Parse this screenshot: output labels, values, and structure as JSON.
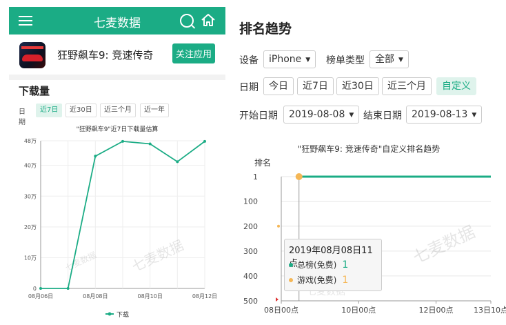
{
  "left": {
    "header": {
      "title": "七麦数据"
    },
    "app": {
      "name": "狂野飙车9: 竞速传奇",
      "follow_label": "关注应用"
    },
    "downloads": {
      "section_title": "下载量",
      "filter_label": "日期",
      "filters": [
        "近7日",
        "近30日",
        "近三个月",
        "近一年"
      ],
      "active_filter": "近7日"
    }
  },
  "right": {
    "title": "排名趋势",
    "device_label": "设备",
    "device_value": "iPhone",
    "chart_type_label": "榜单类型",
    "chart_type_value": "全部",
    "date_label": "日期",
    "date_chips": [
      "今日",
      "近7日",
      "近30日",
      "近三个月",
      "自定义"
    ],
    "active_date": "自定义",
    "start_label": "开始日期",
    "start_value": "2019-08-08",
    "end_label": "结束日期",
    "end_value": "2019-08-13",
    "tooltip": {
      "title": "2019年08月08日11点",
      "rows": [
        {
          "label": "总榜(免费)",
          "value": "1",
          "color": "#1bac85"
        },
        {
          "label": "游戏(免费)",
          "value": "1",
          "color": "#f5b756"
        }
      ]
    },
    "watermark": "七麦数据"
  },
  "colors": {
    "accent": "#1bac85",
    "orange": "#f5b756"
  },
  "chart_data": [
    {
      "type": "line",
      "title": "\"狂野飙车9\"近7日下载量估算",
      "x": [
        "08月06日",
        "08月07日",
        "08月08日",
        "08月09日",
        "08月10日",
        "08月11日",
        "08月12日"
      ],
      "x_tick_labels": [
        "08月06日",
        "08月08日",
        "08月10日",
        "08月12日"
      ],
      "y_tick_labels": [
        "0",
        "10万",
        "20万",
        "30万",
        "40万",
        "48万"
      ],
      "ylim": [
        0,
        480000
      ],
      "series": [
        {
          "name": "下载",
          "color": "#1bac85",
          "values": [
            0,
            0,
            430000,
            478000,
            470000,
            412000,
            478000
          ]
        }
      ],
      "legend": "bottom-center",
      "watermark": "七麦数据"
    },
    {
      "type": "line",
      "title": "\"狂野飙车9: 竞速传奇\"自定义排名趋势",
      "ylabel": "排名",
      "y_inverted": true,
      "ylim": [
        1,
        500
      ],
      "y_tick_labels": [
        "1",
        "100",
        "200",
        "300",
        "400",
        "500"
      ],
      "x_tick_labels": [
        "08日00点",
        "10日00点",
        "12日00点",
        "13日10点"
      ],
      "x_range_hours": [
        0,
        130
      ],
      "series": [
        {
          "name": "总榜(免费)",
          "color": "#1bac85",
          "points": [
            [
              11,
              1
            ],
            [
              130,
              1
            ]
          ]
        },
        {
          "name": "游戏(免费)",
          "color": "#f5b756",
          "points": [
            [
              11,
              1
            ],
            [
              130,
              1
            ]
          ]
        }
      ],
      "outliers": [
        [
          0,
          200
        ]
      ],
      "grid": true
    }
  ]
}
